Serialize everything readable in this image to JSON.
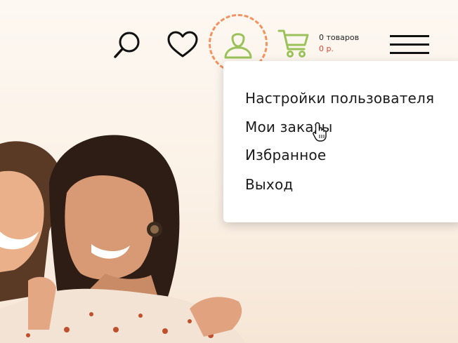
{
  "header": {
    "search_icon": "search-icon",
    "favorites_icon": "heart-icon",
    "account_icon": "user-icon",
    "cart_icon": "cart-icon",
    "cart": {
      "count_text": "0 товаров",
      "sum_text": "0 р."
    },
    "menu_icon": "hamburger-icon",
    "highlight_color": "#f2935f",
    "cart_icon_color": "#9bc25a"
  },
  "account_menu": {
    "items": [
      {
        "label": "Настройки пользователя"
      },
      {
        "label": "Мои заказы"
      },
      {
        "label": "Избранное"
      },
      {
        "label": "Выход"
      }
    ]
  }
}
